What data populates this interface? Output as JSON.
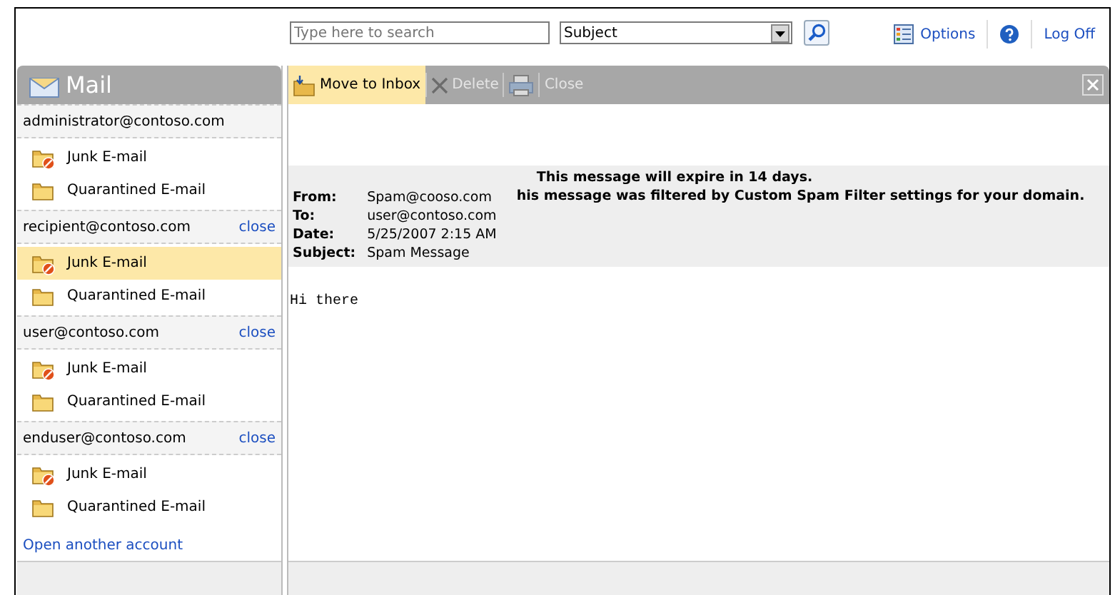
{
  "search": {
    "placeholder": "Type here to search",
    "scope": "Subject"
  },
  "links": [
    {
      "kind": "options",
      "label": "Options"
    },
    {
      "kind": "help"
    },
    {
      "kind": "logoff",
      "label": "Log Off"
    }
  ],
  "sidebar": {
    "title": "Mail",
    "accounts": [
      {
        "email": "administrator@contoso.com",
        "folders": [
          {
            "kind": "junk",
            "label": "Junk E-mail",
            "selected": false
          },
          {
            "kind": "quarantine",
            "label": "Quarantined E-mail",
            "selected": false
          }
        ]
      },
      {
        "email": "recipient@contoso.com",
        "close": "close",
        "folders": [
          {
            "kind": "junk",
            "label": "Junk E-mail",
            "selected": true
          },
          {
            "kind": "quarantine",
            "label": "Quarantined E-mail",
            "selected": false
          }
        ]
      },
      {
        "email": "user@contoso.com",
        "close": "close",
        "folders": [
          {
            "kind": "junk",
            "label": "Junk E-mail",
            "selected": false
          },
          {
            "kind": "quarantine",
            "label": "Quarantined E-mail",
            "selected": false
          }
        ]
      },
      {
        "email": "enduser@contoso.com",
        "close": "close",
        "folders": [
          {
            "kind": "junk",
            "label": "Junk E-mail",
            "selected": false
          },
          {
            "kind": "quarantine",
            "label": "Quarantined E-mail",
            "selected": false
          }
        ]
      }
    ],
    "footer_link": "Open another account"
  },
  "toolbar": [
    {
      "kind": "move",
      "label": "Move to Inbox",
      "disabled": false
    },
    {
      "kind": "delete",
      "label": "Delete",
      "disabled": true
    },
    {
      "kind": "print",
      "disabled": true
    },
    {
      "kind": "close",
      "label": "Close",
      "disabled": true
    }
  ],
  "message": {
    "notices": [
      "This message will expire in 14 days.",
      "his message was filtered by Custom Spam Filter settings for your domain."
    ],
    "headers": [
      {
        "label": "From:",
        "value": "Spam@cooso.com"
      },
      {
        "label": "To:",
        "value": "user@contoso.com"
      },
      {
        "label": "Date:",
        "value": "5/25/2007 2:15 AM"
      },
      {
        "label": "Subject:",
        "value": "Spam Message"
      }
    ],
    "body": "Hi there"
  }
}
